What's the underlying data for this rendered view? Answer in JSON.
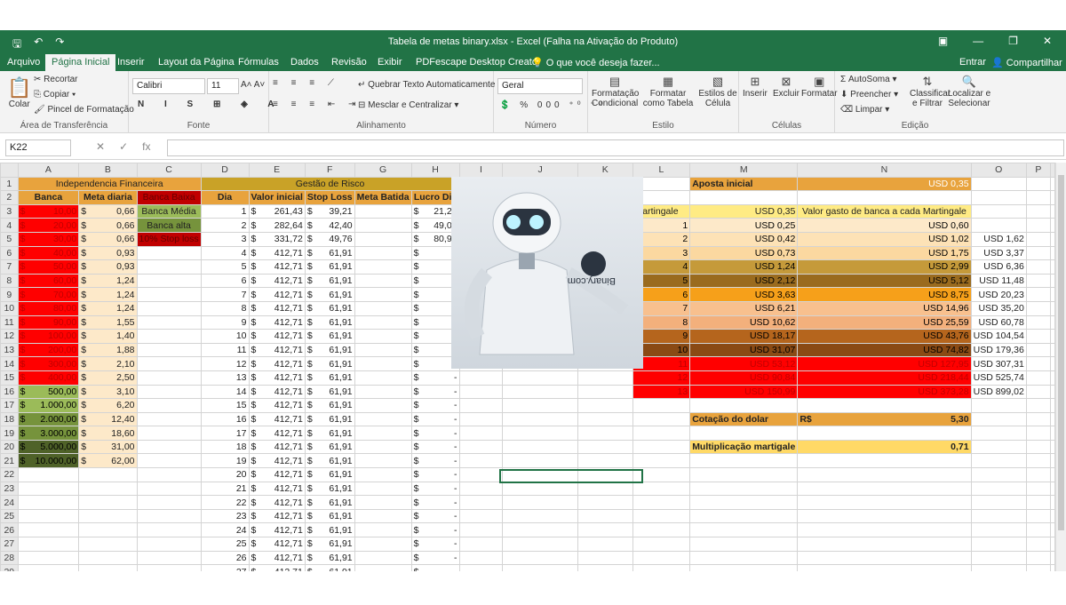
{
  "titlebar": {
    "title": "Tabela de metas binary.xlsx - Excel (Falha na Ativação do Produto)"
  },
  "menu": {
    "items": [
      "Arquivo",
      "Página Inicial",
      "Inserir",
      "Layout da Página",
      "Fórmulas",
      "Dados",
      "Revisão",
      "Exibir",
      "PDFescape Desktop Creator"
    ],
    "tell_me": "O que você deseja fazer...",
    "signin": "Entrar",
    "share": "Compartilhar"
  },
  "ribbon": {
    "clipboard": {
      "paste": "Colar",
      "cut": "Recortar",
      "copy": "Copiar",
      "painter": "Pincel de Formatação",
      "label": "Área de Transferência"
    },
    "font": {
      "name": "Calibri",
      "size": "11",
      "label": "Fonte"
    },
    "alignment": {
      "wrap": "Quebrar Texto Automaticamente",
      "merge": "Mesclar e Centralizar",
      "label": "Alinhamento"
    },
    "number": {
      "format": "Geral",
      "label": "Número"
    },
    "styles": {
      "cond": "Formatação Condicional",
      "table": "Formatar como Tabela",
      "cell": "Estilos de Célula",
      "label": "Estilo"
    },
    "cells": {
      "insert": "Inserir",
      "delete": "Excluir",
      "format": "Formatar",
      "label": "Células"
    },
    "editing": {
      "autosum": "AutoSoma",
      "fill": "Preencher",
      "clear": "Limpar",
      "sort": "Classificar e Filtrar",
      "find": "Localizar e Selecionar",
      "label": "Edição"
    }
  },
  "formula": {
    "namebox": "K22",
    "fx": "fx"
  },
  "columns": [
    "A",
    "B",
    "C",
    "D",
    "E",
    "F",
    "G",
    "H",
    "I",
    "J",
    "K",
    "L",
    "M",
    "N",
    "O",
    "P"
  ],
  "headers": {
    "if": "Independencia Financeira",
    "gr": "Gestão de Risco",
    "banca": "Banca",
    "meta": "Meta diaria",
    "banca_baixa": "Banca Baixa",
    "dia": "Dia",
    "valor_inicial": "Valor inicial",
    "stop_loss": "Stop Loss",
    "meta_batida": "Meta Batida",
    "lucro_dia": "Lucro Dia",
    "banca_media": "Banca Média",
    "banca_alta": "Banca alta",
    "stop": "10% Stop loss",
    "aposta": "Aposta inicial",
    "aposta_val": "USD 0,35",
    "martingale": "Martingale",
    "mart_first": "USD 0,35",
    "valor_gasto": "Valor gasto de banca a cada Martingale",
    "cotacao": "Cotação do dolar",
    "rs": "R$",
    "cot_val": "5,30",
    "mult": "Multiplicação martigale",
    "mult_val": "0,71"
  },
  "banca": [
    [
      "10,00",
      "0,66"
    ],
    [
      "20,00",
      "0,66"
    ],
    [
      "30,00",
      "0,66"
    ],
    [
      "40,00",
      "0,93"
    ],
    [
      "50,00",
      "0,93"
    ],
    [
      "60,00",
      "1,24"
    ],
    [
      "70,00",
      "1,24"
    ],
    [
      "80,00",
      "1,24"
    ],
    [
      "90,00",
      "1,55"
    ],
    [
      "100,00",
      "1,40"
    ],
    [
      "200,00",
      "1,88"
    ],
    [
      "300,00",
      "2,10"
    ],
    [
      "400,00",
      "2,50"
    ],
    [
      "500,00",
      "3,10"
    ],
    [
      "1.000,00",
      "6,20"
    ],
    [
      "2.000,00",
      "12,40"
    ],
    [
      "3.000,00",
      "18,60"
    ],
    [
      "5.000,00",
      "31,00"
    ],
    [
      "10.000,00",
      "62,00"
    ]
  ],
  "risco": [
    [
      "1",
      "261,43",
      "39,21",
      "21,21"
    ],
    [
      "2",
      "282,64",
      "42,40",
      "49,08"
    ],
    [
      "3",
      "331,72",
      "49,76",
      "80,99"
    ],
    [
      "4",
      "412,71",
      "61,91",
      "-"
    ],
    [
      "5",
      "412,71",
      "61,91",
      "-"
    ],
    [
      "6",
      "412,71",
      "61,91",
      "-"
    ],
    [
      "7",
      "412,71",
      "61,91",
      "-"
    ],
    [
      "8",
      "412,71",
      "61,91",
      "-"
    ],
    [
      "9",
      "412,71",
      "61,91",
      "-"
    ],
    [
      "10",
      "412,71",
      "61,91",
      "-"
    ],
    [
      "11",
      "412,71",
      "61,91",
      "-"
    ],
    [
      "12",
      "412,71",
      "61,91",
      "-"
    ],
    [
      "13",
      "412,71",
      "61,91",
      "-"
    ],
    [
      "14",
      "412,71",
      "61,91",
      "-"
    ],
    [
      "15",
      "412,71",
      "61,91",
      "-"
    ],
    [
      "16",
      "412,71",
      "61,91",
      "-"
    ],
    [
      "17",
      "412,71",
      "61,91",
      "-"
    ],
    [
      "18",
      "412,71",
      "61,91",
      "-"
    ],
    [
      "19",
      "412,71",
      "61,91",
      "-"
    ],
    [
      "20",
      "412,71",
      "61,91",
      "-"
    ],
    [
      "21",
      "412,71",
      "61,91",
      "-"
    ],
    [
      "22",
      "412,71",
      "61,91",
      "-"
    ],
    [
      "23",
      "412,71",
      "61,91",
      "-"
    ],
    [
      "24",
      "412,71",
      "61,91",
      "-"
    ],
    [
      "25",
      "412,71",
      "61,91",
      "-"
    ],
    [
      "26",
      "412,71",
      "61,91",
      "-"
    ],
    [
      "27",
      "412,71",
      "61,91",
      "-"
    ]
  ],
  "mart_rows": [
    [
      "1",
      "USD 0,25",
      "USD 0,60",
      ""
    ],
    [
      "2",
      "USD 0,42",
      "USD 1,02",
      "USD 1,62"
    ],
    [
      "3",
      "USD 0,73",
      "USD 1,75",
      "USD 3,37"
    ],
    [
      "4",
      "USD 1,24",
      "USD 2,99",
      "USD 6,36"
    ],
    [
      "5",
      "USD 2,12",
      "USD 5,12",
      "USD 11,48"
    ],
    [
      "6",
      "USD 3,63",
      "USD 8,75",
      "USD 20,23"
    ],
    [
      "7",
      "USD 6,21",
      "USD 14,96",
      "USD 35,20"
    ],
    [
      "8",
      "USD 10,62",
      "USD 25,59",
      "USD 60,78"
    ],
    [
      "9",
      "USD 18,17",
      "USD 43,76",
      "USD 104,54"
    ],
    [
      "10",
      "USD 31,07",
      "USD 74,82",
      "USD 179,36"
    ],
    [
      "11",
      "USD 53,12",
      "USD 127,95",
      "USD 307,31"
    ],
    [
      "12",
      "USD 90,84",
      "USD 218,44",
      "USD 525,74"
    ],
    [
      "13",
      "USD 150,99",
      "USD 373,28",
      "USD 899,02"
    ]
  ],
  "mart_colors": [
    "#fde9c9",
    "#fde2b6",
    "#fbd8a0",
    "#c59a3a",
    "#9a6b1e",
    "#f6a01a",
    "#f8c08e",
    "#f3b07c",
    "#b5651d",
    "#8a4a14",
    "#ff0000",
    "#ff0000",
    "#ff0000"
  ],
  "robot": {
    "logo": "Binary.com"
  },
  "colors": {
    "excel_green": "#217346",
    "header_orange": "#e8a33d",
    "red": "#ff0000",
    "dark_red": "#c00000",
    "green_light": "#9bbb59",
    "green": "#76933c",
    "green_dark": "#4f6228",
    "gold": "#c9a227",
    "cream": "#fde9c9",
    "yellow": "#ffeb84"
  }
}
